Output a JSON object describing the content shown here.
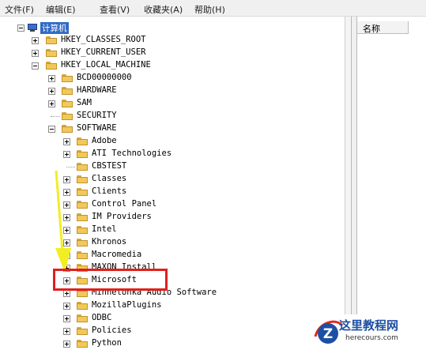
{
  "menubar": {
    "items": [
      "文件(F)",
      "编辑(E)",
      "查看(V)",
      "收藏夹(A)",
      "帮助(H)"
    ]
  },
  "tree": {
    "root": "计算机",
    "hives": [
      "HKEY_CLASSES_ROOT",
      "HKEY_CURRENT_USER",
      "HKEY_LOCAL_MACHINE"
    ],
    "hklm_children": [
      "BCD00000000",
      "HARDWARE",
      "SAM",
      "SECURITY",
      "SOFTWARE"
    ],
    "software_children": [
      "Adobe",
      "ATI Technologies",
      "CBSTEST",
      "Classes",
      "Clients",
      "Control Panel",
      "IM Providers",
      "Intel",
      "Khronos",
      "Macromedia",
      "MAXON Install",
      "Microsoft",
      "Minnetonka Audio Software",
      "MozillaPlugins",
      "ODBC",
      "Policies",
      "Python"
    ]
  },
  "list_pane": {
    "column_name": "名称"
  },
  "annotation": {
    "highlight_color": "#e0201c",
    "arrow_color": "#f2ee22"
  },
  "watermark": {
    "title": "这里教程网",
    "url": "herecours.com",
    "logo_letter": "Z"
  }
}
